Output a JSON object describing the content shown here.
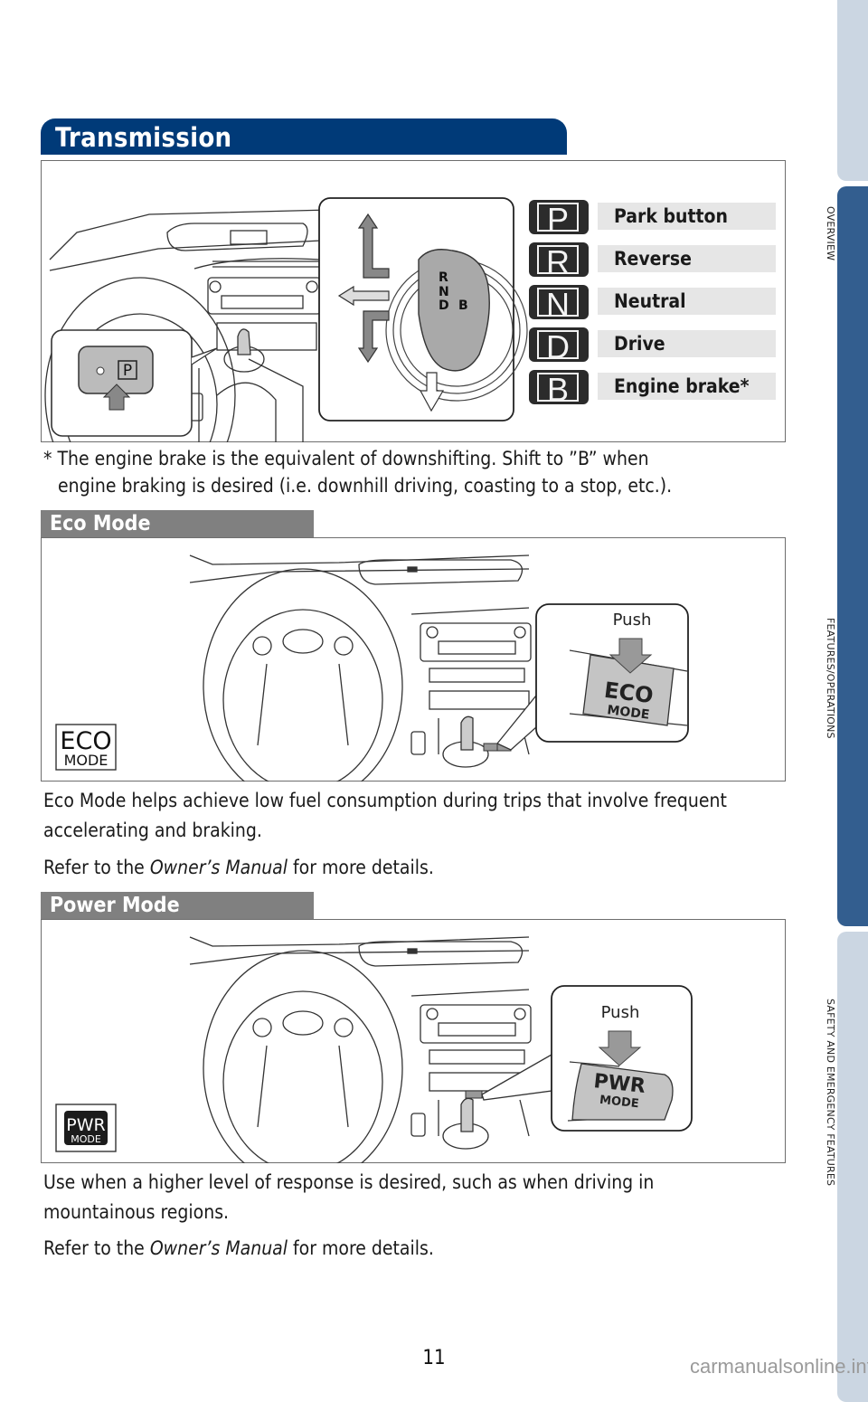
{
  "side_tabs": [
    {
      "label": "OVERVIEW",
      "state": "inactive"
    },
    {
      "label": "FEATURES/OPERATIONS",
      "state": "active"
    },
    {
      "label": "SAFETY AND EMERGENCY FEATURES",
      "state": "inactive"
    }
  ],
  "colors": {
    "heading_blue": "#003a78",
    "subheading_gray": "#808080",
    "tab_active": "#335e8f",
    "tab_inactive": "#cbd6e2"
  },
  "transmission": {
    "title": "Transmission",
    "park_button_symbol": "P",
    "shifter_letters": [
      "R",
      "N",
      "D",
      "B"
    ],
    "gears": [
      {
        "letter": "P",
        "label": "Park button"
      },
      {
        "letter": "R",
        "label": "Reverse"
      },
      {
        "letter": "N",
        "label": "Neutral"
      },
      {
        "letter": "D",
        "label": "Drive"
      },
      {
        "letter": "B",
        "label": "Engine brake*"
      }
    ],
    "footnote_line1": "* The engine brake is the equivalent of downshifting. Shift to ”B” when",
    "footnote_line2": "engine braking is desired (i.e. downhill driving, coasting to a stop, etc.)."
  },
  "eco_mode": {
    "title": "Eco Mode",
    "push_label": "Push",
    "button_line1": "ECO",
    "button_line2": "MODE",
    "icon_line1": "ECO",
    "icon_line2": "MODE",
    "description": "Eco Mode helps achieve low fuel consumption during trips that involve frequent accelerating and braking.",
    "refer_prefix": "Refer to the ",
    "refer_italic": "Owner’s Manual",
    "refer_suffix": " for more details."
  },
  "power_mode": {
    "title": "Power Mode",
    "push_label": "Push",
    "button_line1": "PWR",
    "button_line2": "MODE",
    "icon_line1": "PWR",
    "icon_line2": "MODE",
    "description": "Use when a higher level of response is desired, such as when driving in mountainous regions.",
    "refer_prefix": "Refer to the ",
    "refer_italic": "Owner’s Manual",
    "refer_suffix": " for more details."
  },
  "page_number": "11",
  "watermark": "carmanualsonline.info"
}
